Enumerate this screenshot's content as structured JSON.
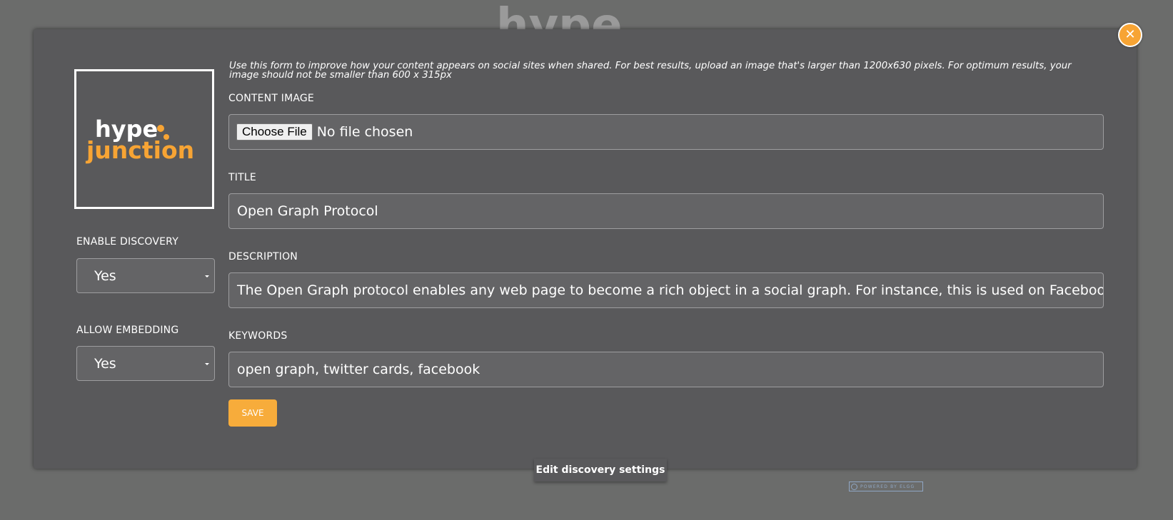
{
  "background_logo_text": "hype",
  "close_button": {
    "symbol": "✕",
    "accent": "#f7a434"
  },
  "preview": {
    "logo_line1": "hype",
    "logo_line2": "junction",
    "logo_white": "#ffffff",
    "logo_orange": "#f7a434"
  },
  "left": {
    "enable_discovery_label": "ENABLE DISCOVERY",
    "enable_discovery_value": "Yes",
    "allow_embedding_label": "ALLOW EMBEDDING",
    "allow_embedding_value": "Yes"
  },
  "form": {
    "intro": "Use this form to improve how your content appears on social sites when shared. For best results, upload an image that's larger than 1200x630 pixels. For optimum results, your image should not be smaller than 600 x 315px",
    "content_image_label": "CONTENT IMAGE",
    "choose_file_label": "Choose File",
    "no_file_text": "No file chosen",
    "title_label": "TITLE",
    "title_value": "Open Graph Protocol",
    "description_label": "DESCRIPTION",
    "description_value": "The Open Graph protocol enables any web page to become a rich object in a social graph. For instance, this is used on Facebook to allow any w",
    "keywords_label": "KEYWORDS",
    "keywords_value": "open graph, twitter cards, facebook",
    "save_label": "SAVE"
  },
  "edit_tab_label": "Edit discovery settings",
  "powered_by": "POWERED BY ELGG",
  "colors": {
    "page_bg": "#6b6c6b",
    "modal_bg": "#59595b",
    "accent": "#f7ac3b"
  }
}
